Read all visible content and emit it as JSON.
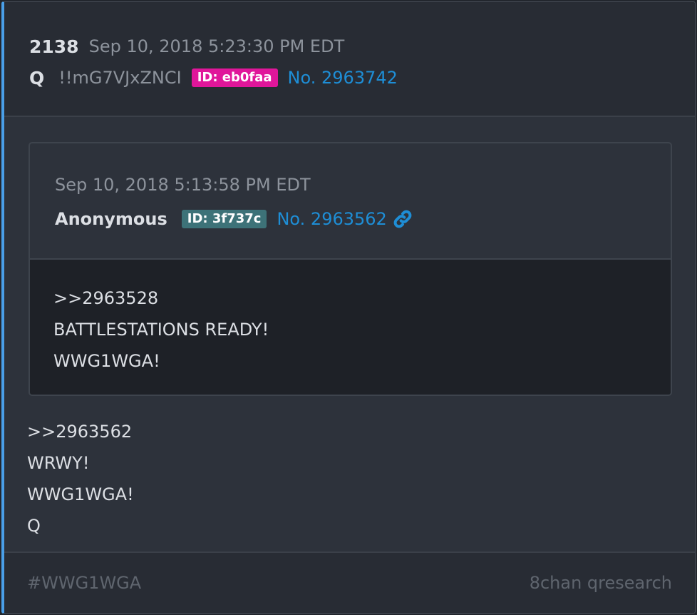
{
  "post": {
    "number": "2138",
    "timestamp": "Sep 10, 2018 5:23:30 PM EDT",
    "author": "Q",
    "tripcode": "!!mG7VJxZNCI",
    "id_badge": "ID: eb0faa",
    "id_color": "#e0169a",
    "post_no": "No. 2963742"
  },
  "quoted_post": {
    "timestamp": "Sep 10, 2018 5:13:58 PM EDT",
    "author": "Anonymous",
    "id_badge": "ID: 3f737c",
    "id_color": "#3d7278",
    "post_no": "No. 2963562",
    "link_icon": "link-icon",
    "lines": [
      ">>2963528",
      "BATTLESTATIONS READY!",
      "WWG1WGA!"
    ]
  },
  "body": {
    "lines": [
      ">>2963562",
      "WRWY!",
      "WWG1WGA!",
      "Q"
    ]
  },
  "footer": {
    "hashtag": "#WWG1WGA",
    "source": "8chan qresearch"
  },
  "colors": {
    "accent": "#4a9fe8",
    "link": "#1e8ed6"
  }
}
